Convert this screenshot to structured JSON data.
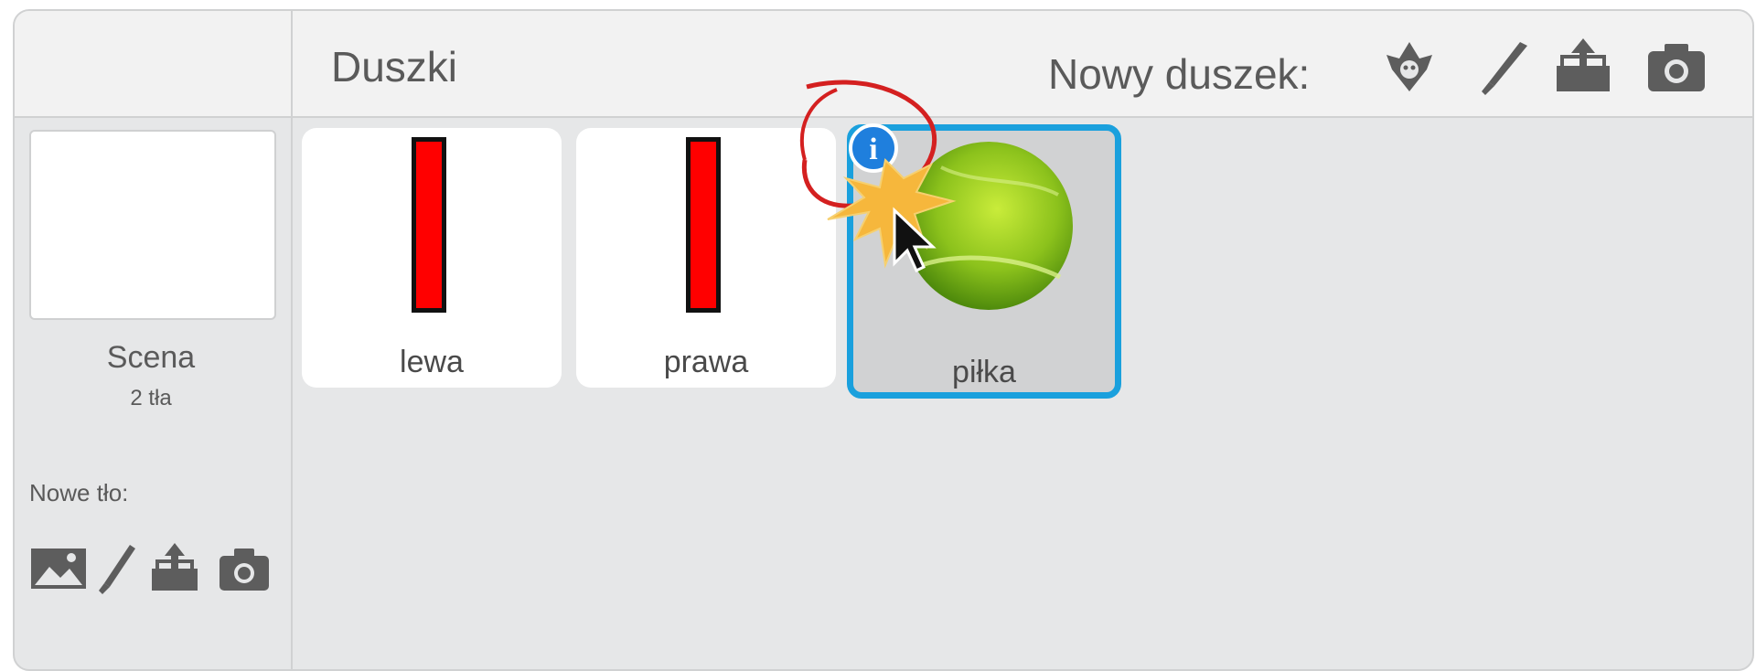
{
  "header": {
    "title": "Duszki",
    "new_sprite_label": "Nowy duszek:",
    "icons": [
      "sprite-library-icon",
      "paint-brush-icon",
      "upload-icon",
      "camera-icon"
    ]
  },
  "stage": {
    "name": "Scena",
    "backdrop_count": "2 tła",
    "new_backdrop_label": "Nowe tło:",
    "icons": [
      "image-library-icon",
      "paint-brush-icon",
      "upload-icon",
      "camera-icon"
    ]
  },
  "sprites": [
    {
      "name": "lewa",
      "selected": false,
      "costume": "red paddle"
    },
    {
      "name": "prawa",
      "selected": false,
      "costume": "red paddle"
    },
    {
      "name": "piłka",
      "selected": true,
      "costume": "tennis ball"
    }
  ],
  "info_button": {
    "icon": "info-icon",
    "glyph": "i"
  },
  "colors": {
    "accent": "#1aa0dd",
    "panel_bg": "#e6e7e8",
    "paddle_red": "#ff0000",
    "annotation": "#d42020"
  }
}
